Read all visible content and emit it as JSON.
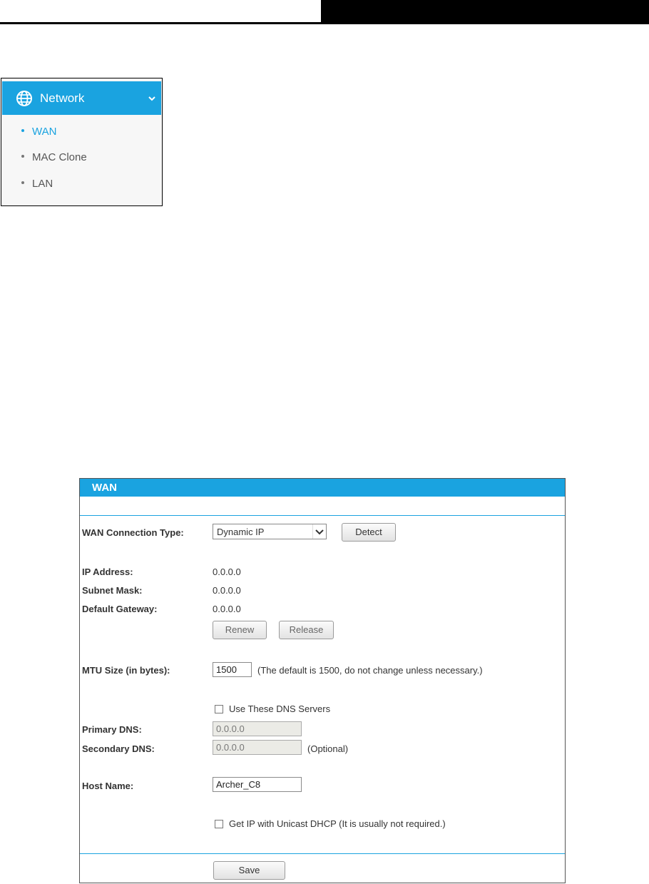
{
  "menu": {
    "title": "Network",
    "items": [
      {
        "label": "WAN",
        "active": true
      },
      {
        "label": "MAC Clone",
        "active": false
      },
      {
        "label": "LAN",
        "active": false
      }
    ],
    "accent": "#1aa3e0",
    "icons": {
      "section": "globe-icon",
      "toggle": "chevron-down-icon"
    }
  },
  "wan": {
    "title": "WAN",
    "connection_type_label": "WAN Connection Type:",
    "connection_type_value": "Dynamic IP",
    "detect_label": "Detect",
    "ip_label": "IP Address:",
    "ip_value": "0.0.0.0",
    "subnet_label": "Subnet Mask:",
    "subnet_value": "0.0.0.0",
    "gateway_label": "Default Gateway:",
    "gateway_value": "0.0.0.0",
    "renew_label": "Renew",
    "release_label": "Release",
    "mtu_label": "MTU Size (in bytes):",
    "mtu_value": "1500",
    "mtu_note": "(The default is 1500, do not change unless necessary.)",
    "dns_checkbox_label": "Use These DNS Servers",
    "primary_dns_label": "Primary DNS:",
    "primary_dns_value": "0.0.0.0",
    "secondary_dns_label": "Secondary DNS:",
    "secondary_dns_value": "0.0.0.0",
    "secondary_note": "(Optional)",
    "host_label": "Host Name:",
    "host_value": "Archer_C8",
    "unicast_label": "Get IP with Unicast DHCP (It is usually not required.)",
    "save_label": "Save"
  }
}
